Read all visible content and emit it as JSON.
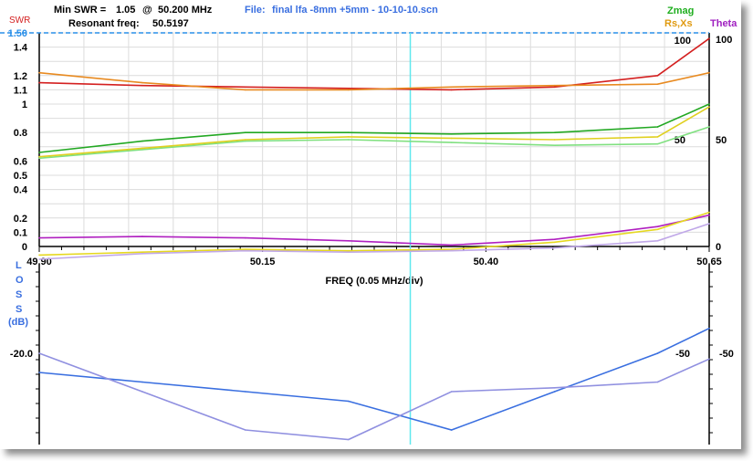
{
  "header": {
    "min_swr_label": "Min SWR =",
    "min_swr_value": "1.05",
    "min_swr_at": "@",
    "min_swr_freq": "50.200 MHz",
    "resonant_label": "Resonant freq:",
    "resonant_value": "50.5197",
    "file_label": "File:",
    "file_name": "final lfa -8mm +5mm - 10-10-10.scn"
  },
  "legend": {
    "swr": "SWR",
    "zmag": "Zmag",
    "rsxs": "Rs,Xs",
    "theta": "Theta",
    "loss_letters": [
      "L",
      "O",
      "S",
      "S"
    ],
    "loss_unit": "(dB)"
  },
  "colors": {
    "swr_axis": "#d42020",
    "zmag": "#1fae1f",
    "rsxs": "#e09a10",
    "theta": "#a020c0",
    "loss": "#3a6fe0",
    "file": "#3a6fe0",
    "cursor": "#5ee8ee",
    "dash": "#2a8fe8"
  },
  "chart_data": [
    {
      "type": "line",
      "name": "impedance-panel",
      "x": [
        50.0,
        50.1,
        50.2,
        50.3,
        50.4,
        50.5,
        50.6,
        50.65
      ],
      "xlim": [
        50.0,
        50.65
      ],
      "x_ticks": [
        "49.90",
        "50.15",
        "50.40",
        "50.65"
      ],
      "xlabel": "FREQ (0.05 MHz/div)",
      "ylim_left": [
        0,
        1.5
      ],
      "y_ticks_left": [
        "1.50",
        "1.4",
        "1.2",
        "1.1",
        "1",
        "0.8",
        "0.6",
        "0.5",
        "0.4",
        "0.2",
        "0.1",
        "0"
      ],
      "y_ticks_right": [
        "100",
        "50",
        "0"
      ],
      "right_inner_labels": [
        "100",
        "50"
      ],
      "ylim_right": [
        0,
        100
      ],
      "cursor_x": 50.36,
      "series": [
        {
          "name": "SWR (red)",
          "color": "#d42020",
          "values": [
            1.15,
            1.13,
            1.12,
            1.11,
            1.1,
            1.12,
            1.2,
            1.46
          ]
        },
        {
          "name": "SWR (orange)",
          "color": "#e88a20",
          "values": [
            1.22,
            1.15,
            1.1,
            1.1,
            1.12,
            1.13,
            1.14,
            1.22
          ]
        },
        {
          "name": "Zmag",
          "color": "#22a822",
          "values": [
            0.66,
            0.74,
            0.8,
            0.8,
            0.79,
            0.8,
            0.84,
            1.0
          ]
        },
        {
          "name": "Zmag (light)",
          "color": "#80e080",
          "values": [
            0.62,
            0.68,
            0.74,
            0.75,
            0.73,
            0.71,
            0.72,
            0.84
          ]
        },
        {
          "name": "Rs",
          "color": "#e0d020",
          "values": [
            0.63,
            0.69,
            0.75,
            0.77,
            0.76,
            0.75,
            0.77,
            0.98
          ]
        },
        {
          "name": "Theta",
          "color": "#b020c0",
          "values": [
            0.06,
            0.07,
            0.06,
            0.04,
            0.01,
            0.05,
            0.14,
            0.22
          ]
        },
        {
          "name": "Xs",
          "color": "#e6d820",
          "values": [
            -0.06,
            -0.04,
            -0.02,
            -0.03,
            -0.02,
            0.03,
            0.12,
            0.24
          ]
        },
        {
          "name": "Theta (light)",
          "color": "#c0a8e8",
          "values": [
            -0.09,
            -0.05,
            -0.03,
            -0.04,
            -0.03,
            -0.01,
            0.04,
            0.16
          ]
        }
      ]
    },
    {
      "type": "line",
      "name": "loss-panel",
      "x": [
        50.0,
        50.1,
        50.2,
        50.3,
        50.4,
        50.5,
        50.6,
        50.65
      ],
      "ylabel": "LOSS (dB)",
      "y_tick_left": "-20.0",
      "y_tick_right": "-50",
      "inner_label": "-50",
      "series": [
        {
          "name": "Loss",
          "color": "#3a6fe0",
          "values": [
            -21.0,
            -21.5,
            -22.0,
            -22.5,
            -24.0,
            -22.0,
            -20.0,
            -18.7
          ]
        },
        {
          "name": "Loss (light)",
          "color": "#9090e0",
          "values": [
            -20.0,
            -22.0,
            -24.0,
            -24.5,
            -22.0,
            -21.8,
            -21.5,
            -20.3
          ]
        }
      ]
    }
  ]
}
